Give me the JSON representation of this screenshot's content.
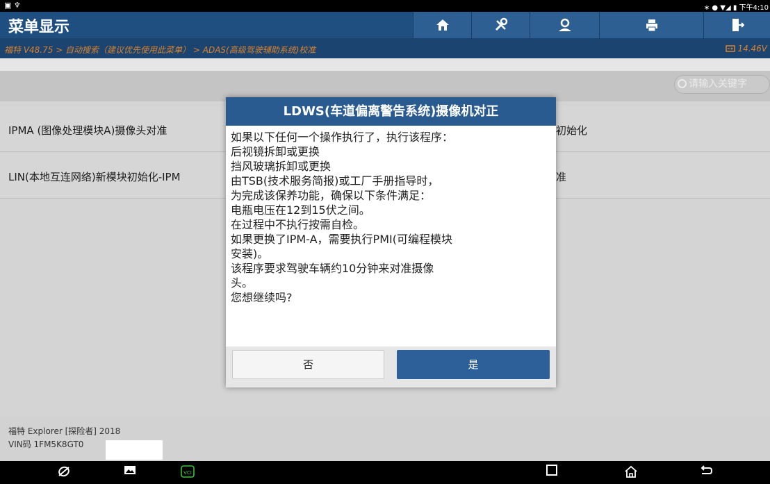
{
  "status_bar": {
    "left_icons": "▣ ♆",
    "right_text": "∗ ● ▼◢ ▮ 下午4:10"
  },
  "header": {
    "title": "菜单显示",
    "breadcrumb": "福特 V48.75 > 自动搜索（建议优先使用此菜单） > ADAS(高级驾驶辅助系统)校准",
    "voltage": "14.46V",
    "toolbar_icons": [
      "home-icon",
      "tools-icon",
      "user-icon",
      "print-icon",
      "exit-icon"
    ]
  },
  "search": {
    "placeholder": "请输入关键字"
  },
  "menu": {
    "items": [
      {
        "label": "IPMA (图像处理模块A)摄像头对准"
      },
      {
        "label": "初始化"
      },
      {
        "label": "LIN(本地互连网络)新模块初始化-IPM"
      },
      {
        "label": "准"
      }
    ]
  },
  "dialog": {
    "title": "LDWS(车道偏离警告系统)摄像机对正",
    "body": "如果以下任何一个操作执行了，执行该程序：\n 后视镜拆卸或更换\n 挡风玻璃拆卸或更换\n 由TSB(技术服务简报)或工厂手册指导时，\n 为完成该保养功能，确保以下条件满足：\n 电瓶电压在12到15伏之间。\n 在过程中不执行按需自检。\n 如果更换了IPM-A，需要执行PMI(可编程模块\n安装)。\n 该程序要求驾驶车辆约10分钟来对准摄像\n头。\n 您想继续吗?",
    "no_label": "否",
    "yes_label": "是"
  },
  "footer": {
    "vehicle": "福特 Explorer [探险者] 2018",
    "vin": "VIN码 1FM5K8GT0"
  },
  "nav_bar": {
    "vci_label": "VCI",
    "icons": [
      "browser-icon",
      "gallery-icon",
      "vci-icon",
      "recent-apps-icon",
      "home-nav-icon",
      "back-icon"
    ]
  }
}
